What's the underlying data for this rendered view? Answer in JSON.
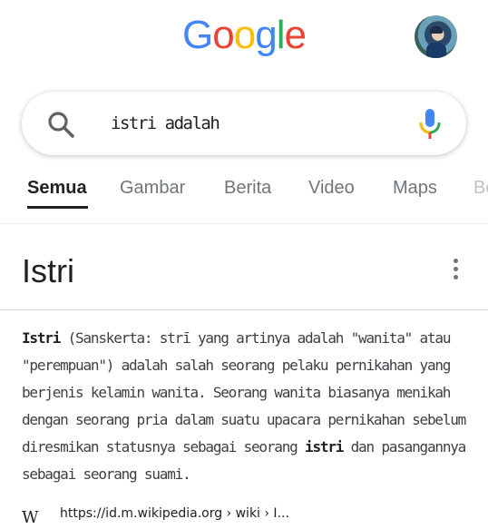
{
  "logo": {
    "letters": [
      {
        "ch": "G",
        "color": "#4285F4"
      },
      {
        "ch": "o",
        "color": "#EA4335"
      },
      {
        "ch": "o",
        "color": "#FBBC05"
      },
      {
        "ch": "g",
        "color": "#4285F4"
      },
      {
        "ch": "l",
        "color": "#34A853"
      },
      {
        "ch": "e",
        "color": "#EA4335"
      }
    ]
  },
  "search": {
    "query": "istri adalah"
  },
  "tabs": [
    "Semua",
    "Gambar",
    "Berita",
    "Video",
    "Maps",
    "Bo"
  ],
  "knowledge_panel": {
    "title": "Istri",
    "term": "Istri",
    "desc_part1": " (Sanskerta: strī yang artinya adalah \"wanita\" atau \"perempuan\") adalah salah seorang pelaku pernikahan yang berjenis kelamin wanita. Seorang wanita biasanya menikah dengan seorang pria dalam suatu upacara pernikahan sebelum diresmikan statusnya sebagai seorang ",
    "term2": "istri",
    "desc_part2": " dan pasangannya sebagai seorang suami.",
    "source_icon": "W",
    "source_url": "https://id.m.wikipedia.org › wiki › I..."
  },
  "colors": {
    "active_tab": "#202124",
    "inactive_tab": "#70757a"
  }
}
